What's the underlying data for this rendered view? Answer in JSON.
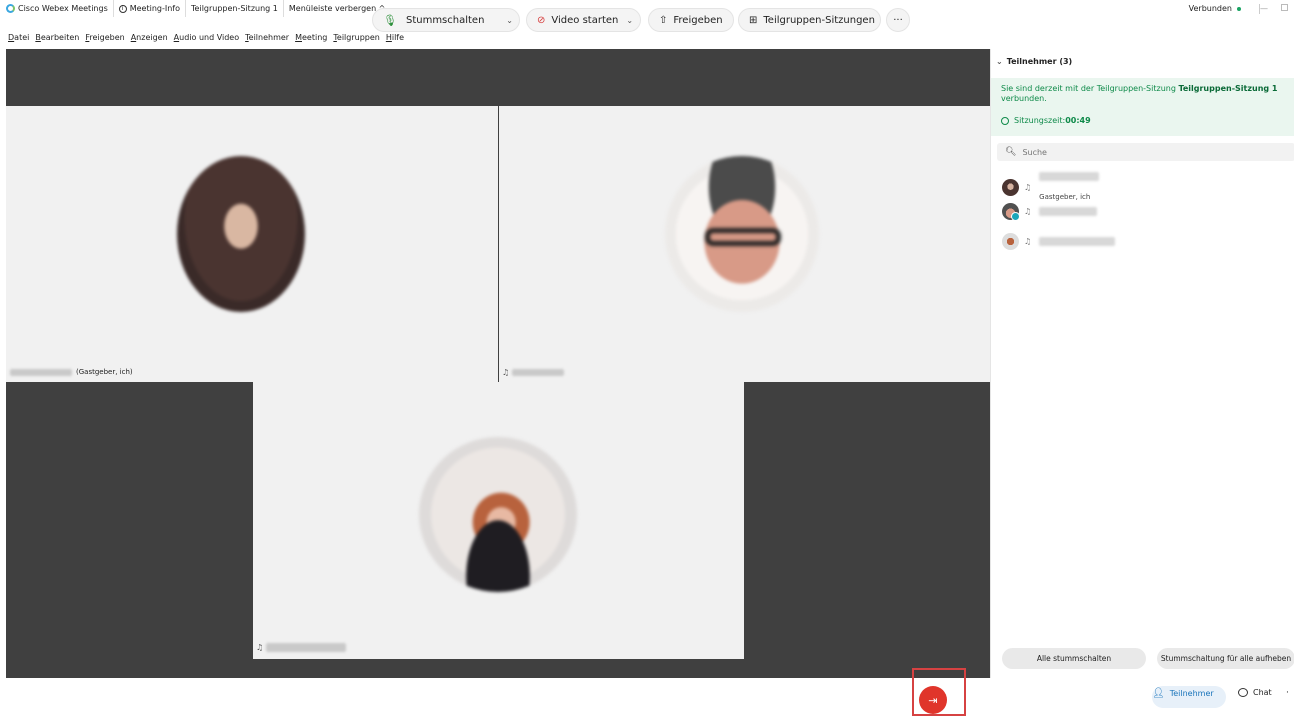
{
  "titlebar": {
    "app_name": "Cisco Webex Meetings",
    "meeting_info": "Meeting-Info",
    "breakout_session": "Teilgruppen-Sitzung 1",
    "hide_menu": "Menüleiste verbergen ^",
    "status": "Verbunden",
    "minimize": "—"
  },
  "menu": {
    "items": [
      "Datei",
      "Bearbeiten",
      "Freigeben",
      "Anzeigen",
      "Audio und Video",
      "Teilnehmer",
      "Meeting",
      "Teilgruppen",
      "Hilfe"
    ]
  },
  "videos": {
    "tile1_label": "(Gastgeber, ich)"
  },
  "panel": {
    "header": "Teilnehmer (3)",
    "notice_prefix": "Sie sind derzeit mit der Teilgruppen-Sitzung ",
    "notice_session": "Teilgruppen-Sitzung 1",
    "notice_suffix": "verbunden.",
    "session_time_label": "Sitzungszeit: ",
    "session_time_value": "00:49",
    "search_placeholder": "Suche",
    "participants": [
      {
        "role": "Gastgeber, ich"
      },
      {
        "role": ""
      },
      {
        "role": ""
      }
    ],
    "mute_all": "Alle stummschalten",
    "unmute_all": "Stummschaltung für alle aufheben"
  },
  "toolbar": {
    "mute": "Stummschalten",
    "video": "Video starten",
    "share": "Freigeben",
    "breakout": "Teilgruppen-Sitzungen",
    "more": "···",
    "participants": "Teilnehmer",
    "chat": "Chat",
    "overflow": "·"
  },
  "colors": {
    "accent_green": "#0e8a49",
    "end_red": "#e0352b",
    "highlight_red": "#d64242",
    "link_blue": "#1b75bb"
  }
}
